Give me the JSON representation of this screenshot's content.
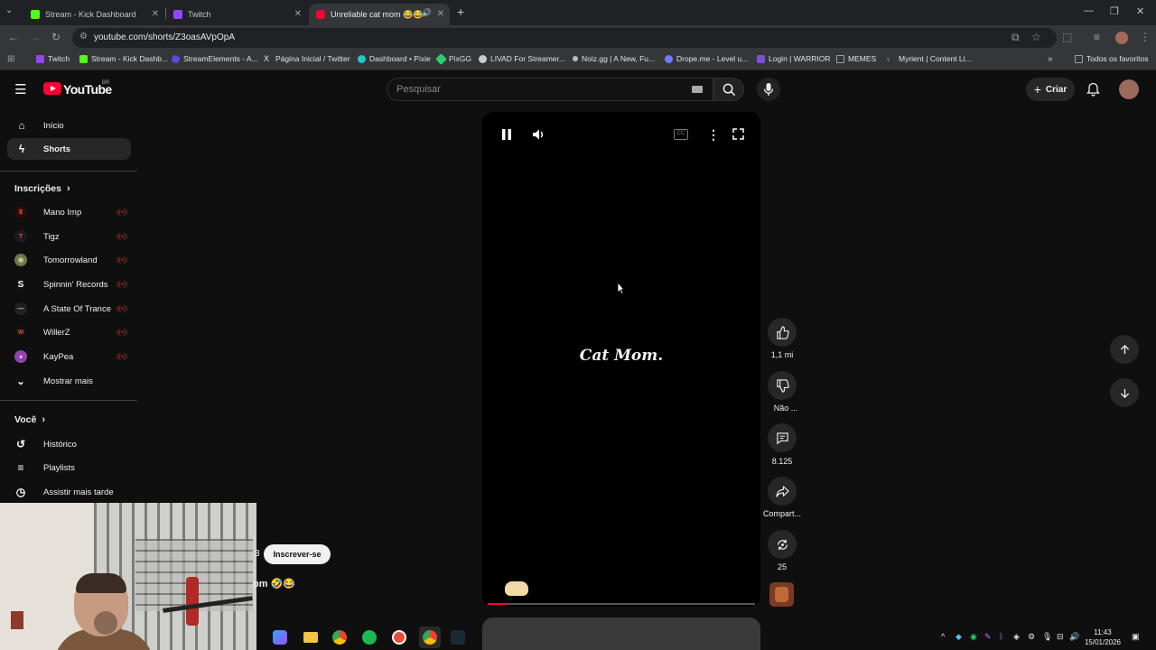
{
  "browser": {
    "tabs": [
      {
        "title": "Stream - Kick Dashboard",
        "color": "#53fc18"
      },
      {
        "title": "Twitch",
        "color": "#9146ff"
      },
      {
        "title": "Unreliable cat mom 😂😂",
        "color": "#ff0033"
      }
    ],
    "url": "youtube.com/shorts/Z3oasAVpOpA",
    "bookmarks": [
      {
        "label": "Twitch",
        "color": "#9146ff"
      },
      {
        "label": "Stream - Kick Dashb...",
        "color": "#53fc18"
      },
      {
        "label": "StreamElements - A...",
        "color": "#5b4bdb"
      },
      {
        "label": "Página Inicial / Twitter",
        "color": "#e8e8e8"
      },
      {
        "label": "Dashboard • Pixie",
        "color": "#28c6c6"
      },
      {
        "label": "PixGG",
        "color": "#2ecc71"
      },
      {
        "label": "LIVAD For Streamer...",
        "color": "#cccccc"
      },
      {
        "label": "Noiz.gg | A New, Fu...",
        "color": "#bbbbbb"
      },
      {
        "label": "Drope.me - Level u...",
        "color": "#6b7cff"
      },
      {
        "label": "Login | WARRIOR",
        "color": "#7b4fd6"
      },
      {
        "label": "MEMES",
        "color": "#9aa0a6"
      },
      {
        "label": "Myrient | Content Li...",
        "color": "#9aa0a6"
      }
    ],
    "all_bookmarks": "Todos os favoritos"
  },
  "youtube": {
    "logo": "YouTube",
    "region": "BR",
    "search_placeholder": "Pesquisar",
    "create_label": "Criar",
    "sidebar": {
      "home": "Início",
      "shorts": "Shorts",
      "subscriptions_header": "Inscrições",
      "subscriptions": [
        {
          "name": "Mano Imp",
          "color": "#8a1c1c",
          "initial": "♜"
        },
        {
          "name": "Tigz",
          "color": "#c0392b",
          "initial": "T"
        },
        {
          "name": "Tomorrowland",
          "color": "#6b7a4a",
          "initial": "◉"
        },
        {
          "name": "Spinnin' Records",
          "color": "#111111",
          "initial": "S"
        },
        {
          "name": "A State Of Trance",
          "color": "#222222",
          "initial": "—"
        },
        {
          "name": "WillerZ",
          "color": "#8b1a1a",
          "initial": "W"
        },
        {
          "name": "KayPea",
          "color": "#8e44ad",
          "initial": "◕"
        }
      ],
      "show_more": "Mostrar mais",
      "you_header": "Você",
      "history": "Histórico",
      "playlists": "Playlists",
      "watch_later": "Assistir mais tarde"
    },
    "short": {
      "caption": "Cat Mom.",
      "progress": 0.07,
      "likes": "1,1 mi",
      "dislike_label": "Não ...",
      "comments": "8.125",
      "share_label": "Compart...",
      "remix_count": "25",
      "subscribe_label": "Inscrever-se",
      "title_fragment": "om 🤣😂",
      "channel_fragment": "3"
    }
  },
  "taskbar": {
    "time": "11:43",
    "date": "15/01/2026"
  }
}
